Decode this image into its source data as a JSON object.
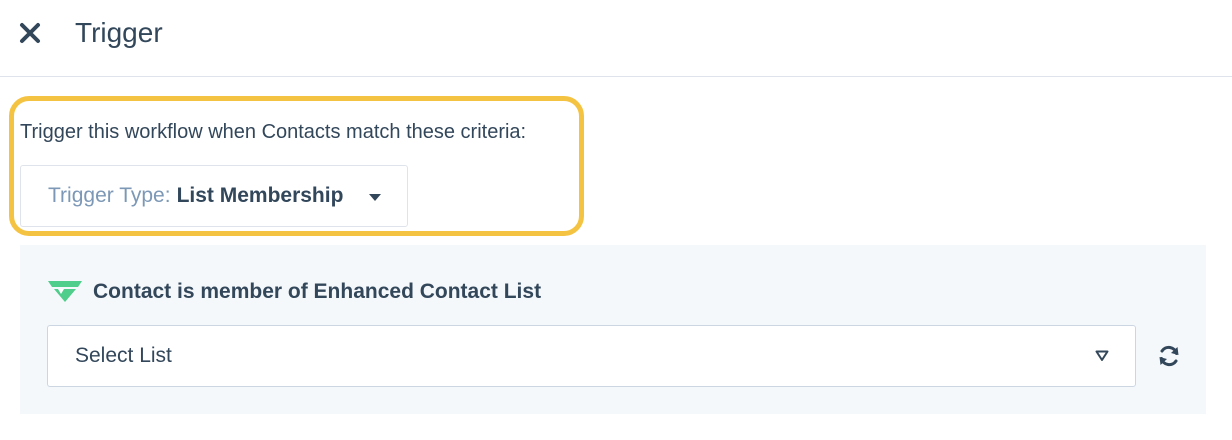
{
  "header": {
    "close_icon": "close-icon",
    "title": "Trigger"
  },
  "criteria": {
    "text": "Trigger this workflow when Contacts match these criteria:",
    "trigger_type_label": "Trigger Type:",
    "trigger_type_value": "List Membership",
    "highlight_color": "#f5c342"
  },
  "panel": {
    "icon": "integration-logo-icon",
    "title": "Contact is member of Enhanced Contact List",
    "select_placeholder": "Select List",
    "refresh_icon": "refresh-icon",
    "background": "#f5f8fa",
    "icon_color": "#4fcd8b"
  }
}
